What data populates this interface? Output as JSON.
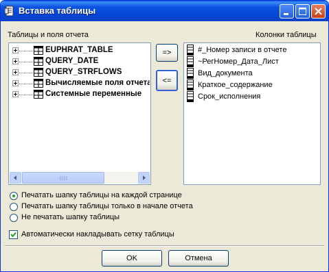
{
  "window": {
    "title": "Вставка таблицы"
  },
  "left_panel": {
    "label": "Таблицы и поля отчета",
    "items": [
      {
        "label": "EUPHRAT_TABLE"
      },
      {
        "label": "QUERY_DATE"
      },
      {
        "label": "QUERY_STRFLOWS"
      },
      {
        "label": "Вычисляемые поля отчета"
      },
      {
        "label": "Системные переменные"
      }
    ]
  },
  "right_panel": {
    "label": "Колонки таблицы",
    "items": [
      {
        "label": "#_Номер записи в отчете"
      },
      {
        "label": "~РегНомер_Дата_Лист"
      },
      {
        "label": "Вид_документа"
      },
      {
        "label": "Краткое_содержание"
      },
      {
        "label": "Срок_исполнения"
      }
    ]
  },
  "move_buttons": {
    "add": "=>",
    "remove": "<="
  },
  "options": {
    "radios": [
      {
        "label": "Печатать шапку таблицы на каждой странице",
        "checked": true
      },
      {
        "label": "Печатать шапку таблицы только в начале отчета",
        "checked": false
      },
      {
        "label": "Не печатать шапку таблицы",
        "checked": false
      }
    ],
    "grid_checkbox": {
      "label": "Автоматически накладывать сетку таблицы",
      "checked": true
    }
  },
  "footer": {
    "ok": "OK",
    "cancel": "Отмена"
  }
}
